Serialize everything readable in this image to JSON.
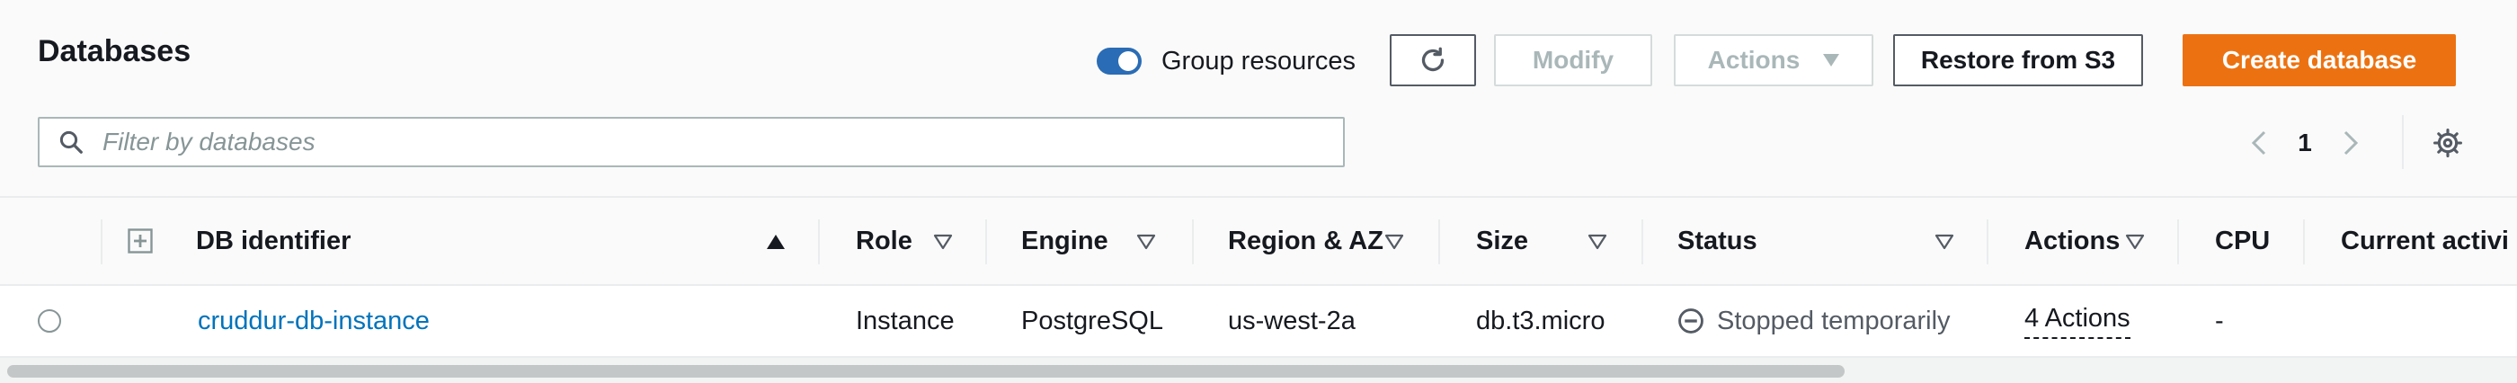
{
  "header": {
    "title": "Databases",
    "group_resources": {
      "label": "Group resources",
      "enabled": true
    },
    "buttons": {
      "refresh": "refresh-icon",
      "modify": "Modify",
      "actions": "Actions",
      "restore": "Restore from S3",
      "create": "Create database"
    }
  },
  "search": {
    "placeholder": "Filter by databases",
    "value": ""
  },
  "pagination": {
    "current_page": "1"
  },
  "table": {
    "columns": [
      "DB identifier",
      "Role",
      "Engine",
      "Region & AZ",
      "Size",
      "Status",
      "Actions",
      "CPU",
      "Current activi"
    ],
    "rows": [
      {
        "db_identifier": "cruddur-db-instance",
        "role": "Instance",
        "engine": "PostgreSQL",
        "region_az": "us-west-2a",
        "size": "db.t3.micro",
        "status": "Stopped temporarily",
        "actions": "4 Actions",
        "cpu": "-"
      }
    ]
  },
  "colors": {
    "accent": "#ec7211",
    "link": "#0073bb",
    "toggle": "#2a6cb5"
  }
}
